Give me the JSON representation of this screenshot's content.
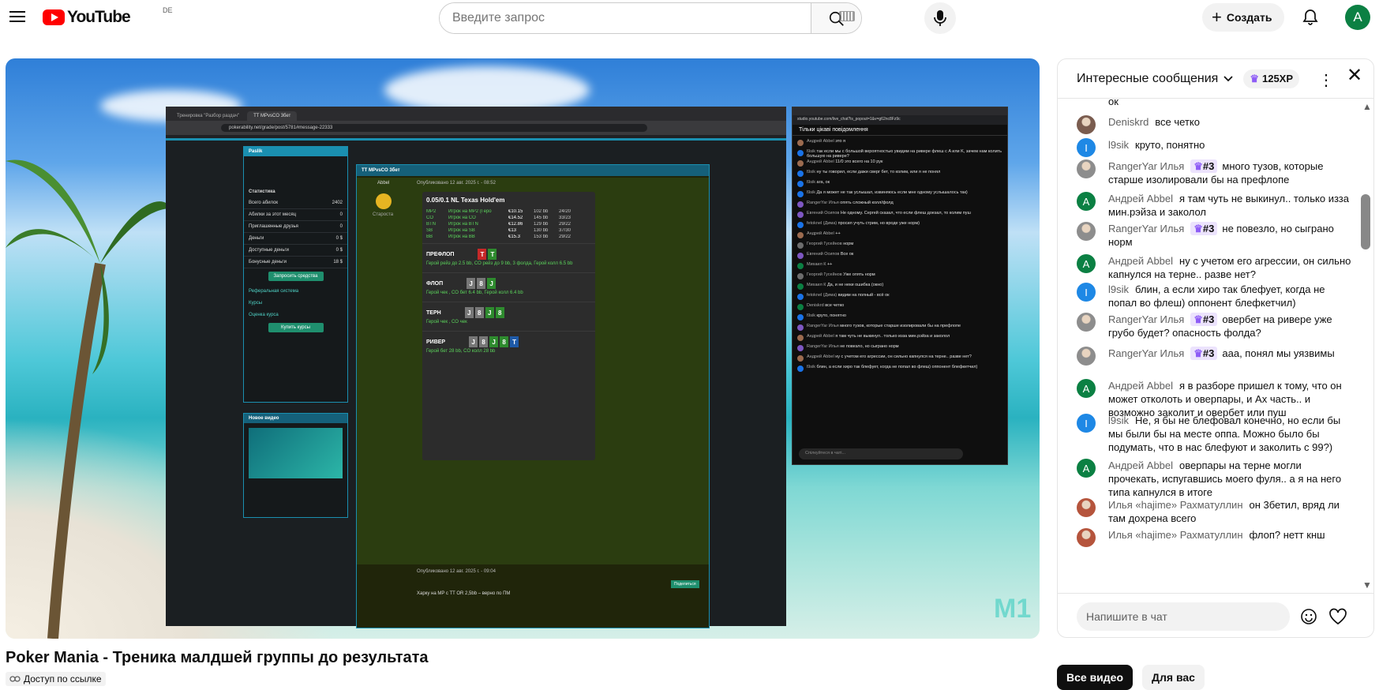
{
  "header": {
    "logo_text": "YouTube",
    "country_code": "DE",
    "search_placeholder": "Введите запрос",
    "create_label": "Создать",
    "avatar_letter": "A"
  },
  "video": {
    "title": "Poker Mania - Треника малдшей группы до результата",
    "access_label": "Доступ по ссылке",
    "watermark": "M1"
  },
  "screen_browser": {
    "tab1": "Тренировка \"Разбор раздач\"",
    "tab2": "TT MPvsCO 3бет",
    "url": "pokerability.net/grade/post/5781#message-22333",
    "user": "Paslik",
    "stats_title": "Статистика",
    "stats": [
      {
        "k": "Всего абилок",
        "v": "2402"
      },
      {
        "k": "Абилки за этот месяц",
        "v": "0"
      },
      {
        "k": "Приглашенные друзья",
        "v": "0"
      },
      {
        "k": "Деньги",
        "v": "0 $"
      },
      {
        "k": "Доступные деньги",
        "v": "0 $"
      },
      {
        "k": "Бонусные деньги",
        "v": "18 $"
      }
    ],
    "withdraw_btn": "Запросить средства",
    "links": [
      "Реферальная система",
      "Курсы",
      "Оценка курса"
    ],
    "buy_btn": "Купить курсы",
    "new_video": "Новое видео",
    "post_title": "TT MPvsCO 3бет",
    "author": "Abbel",
    "rank": "Староста",
    "published": "Опубликовано 12 авг. 2025 г. - 08:52",
    "game": "0.05/0.1 NL Texas Hold'em",
    "players": [
      {
        "pos": "MP2",
        "name": "Игрок на MP2 (Геро",
        "stack": "€10.15",
        "bb": "102 bb",
        "stat": "24/20"
      },
      {
        "pos": "CO",
        "name": "Игрок на CO",
        "stack": "€14.52",
        "bb": "145 bb",
        "stat": "33/23"
      },
      {
        "pos": "BTN",
        "name": "Игрок на BTN",
        "stack": "€12.86",
        "bb": "129 bb",
        "stat": "29/22"
      },
      {
        "pos": "SB",
        "name": "Игрок на SB",
        "stack": "€13",
        "bb": "130 bb",
        "stat": "37/30"
      },
      {
        "pos": "BB",
        "name": "Игрок на BB",
        "stack": "€15.3",
        "bb": "153 bb",
        "stat": "29/22"
      }
    ],
    "streets": [
      {
        "name": "ПРЕФЛОП",
        "cards": [
          "T",
          "T"
        ],
        "colors": [
          "r",
          "g"
        ],
        "action": "Герой рейз до 2.5 bb, CO рейз до 9 bb, 3 фолда, Герой колл 6.5 bb"
      },
      {
        "name": "ФЛОП",
        "cards": [
          "J",
          "8",
          "J"
        ],
        "colors": [
          "",
          "",
          "g"
        ],
        "action": "Герой чек , CO бет 6.4 bb, Герой колл 6.4 bb"
      },
      {
        "name": "ТЕРН",
        "cards": [
          "J",
          "8",
          "J",
          "8"
        ],
        "colors": [
          "",
          "",
          "g",
          "g"
        ],
        "action": "Герой чек , CO чек"
      },
      {
        "name": "РИВЕР",
        "cards": [
          "J",
          "8",
          "J",
          "8",
          "T"
        ],
        "colors": [
          "",
          "",
          "g",
          "g",
          "b"
        ],
        "action": "Герой бет 28 bb, CO колл 28 bb"
      }
    ],
    "share_btn": "Поделиться",
    "reply_published": "Опубликовано 12 авг. 2025 г. - 09:04",
    "reply_line": "Харку на MP c TT OR 2,5bb – верно по ПМ"
  },
  "screen_chat": {
    "url": "studio.youtube.com/live_chat?is_popout=1&v=g62nc8Fz9c",
    "header": "Тільки цікаві повідомлення",
    "input": "Спілкуйтеся в чаті...",
    "messages": [
      {
        "a": "Андрей Abbel",
        "t": "это я"
      },
      {
        "a": "l9sik",
        "t": "так если мы с большой вероятностью увидим на ривере флеш с A или K, зачем нам колить большую на ривере?"
      },
      {
        "a": "Андрей Abbel",
        "t": "11/0 это всего на 10 рук"
      },
      {
        "a": "l9sik",
        "t": "ну ты говорил, если дажи сверг бет, то колим, или я не понял"
      },
      {
        "a": "l9sik",
        "t": "ага, ок"
      },
      {
        "a": "l9sik",
        "t": "Да я может не так услышал, извиняюсь если мне одному услышалось так)"
      },
      {
        "a": "RangerYar Илья",
        "t": "опять сложный колл/фолд"
      },
      {
        "a": "Евгений Осипов",
        "t": "Не одному. Сергей сказал, что если флеш доезал, то колим пуш"
      },
      {
        "a": "fetoknel (Дима)",
        "t": "просил учуть стрим, но вроде уже норм)"
      },
      {
        "a": "Андрей Abbel",
        "t": "++"
      },
      {
        "a": "Георгий Гусейнов",
        "t": "норм"
      },
      {
        "a": "Евгений Осипов",
        "t": "Все ок"
      },
      {
        "a": "Михаил К",
        "t": "++"
      },
      {
        "a": "Георгий Гусейнов",
        "t": "Уже опять норм"
      },
      {
        "a": "Михаил К",
        "t": "Да, и не неки ошибка (окно)"
      },
      {
        "a": "fetoknel (Дима)",
        "t": "видим на полный - всё ок"
      },
      {
        "a": "Deniskrd",
        "t": "все четко"
      },
      {
        "a": "l9sik",
        "t": "круто, понятно"
      },
      {
        "a": "RangerYar Илья",
        "t": "много тузов, которые старше изолировали бы на префлопе"
      },
      {
        "a": "Андрей Abbel",
        "t": "я там чуть не выкинул.. только изза мин.рэйза и заколол"
      },
      {
        "a": "RangerYar Илья",
        "t": "не повезло, но сыграно норм"
      },
      {
        "a": "Андрей Abbel",
        "t": "ну с учетом его агрессии, он сильно капнулся на терне.. разве нет?"
      },
      {
        "a": "l9sik",
        "t": "блин, а если хиро так блефует, когда не попал во флеш) оппонент блефкетчил)"
      }
    ]
  },
  "chat": {
    "header_title": "Интересные сообщения",
    "xp_label": "125XP",
    "input_placeholder": "Напишите в чат",
    "partial_top": "ок",
    "messages": [
      {
        "author": "Deniskrd",
        "badge": "",
        "text": "все четко",
        "avatar": "img",
        "color": "#7a5c4f"
      },
      {
        "author": "l9sik",
        "badge": "",
        "text": "круто, понятно",
        "avatar": "I",
        "color": "#1e88e5"
      },
      {
        "author": "RangerYar Илья",
        "badge": "#3",
        "text": "много тузов, которые старше изолировали бы на префлопе",
        "avatar": "img",
        "color": "#8d8d8d"
      },
      {
        "author": "Андрей Abbel",
        "badge": "",
        "text": "я там чуть не выкинул.. только изза мин.рэйза и заколол",
        "avatar": "A",
        "color": "#0b8043"
      },
      {
        "author": "RangerYar Илья",
        "badge": "#3",
        "text": "не повезло, но сыграно норм",
        "avatar": "img",
        "color": "#8d8d8d"
      },
      {
        "author": "Андрей Abbel",
        "badge": "",
        "text": "ну с учетом его агрессии, он сильно капнулся на терне.. разве нет?",
        "avatar": "A",
        "color": "#0b8043"
      },
      {
        "author": "l9sik",
        "badge": "",
        "text": "блин, а если хиро так блефует, когда не попал во флеш) оппонент блефкетчил)",
        "avatar": "I",
        "color": "#1e88e5"
      },
      {
        "author": "RangerYar Илья",
        "badge": "#3",
        "text": "овербет на ривере уже грубо будет? опасность фолда?",
        "avatar": "img",
        "color": "#8d8d8d"
      },
      {
        "author": "RangerYar Илья",
        "badge": "#3",
        "text": "ааа, понял мы уязвимы",
        "avatar": "img",
        "color": "#8d8d8d"
      },
      {
        "author": "Андрей Abbel",
        "badge": "",
        "text": "я в разборе пришел к тому, что он может отколоть и оверпары, и Ax часть.. и возможно заколит и овербет или пуш",
        "avatar": "A",
        "color": "#0b8043"
      },
      {
        "author": "l9sik",
        "badge": "",
        "text": "Не, я бы не блефовал конечно, но если бы мы были бы на месте оппа. Можно было бы подумать, что в нас блефуют и заколить с 99?)",
        "avatar": "I",
        "color": "#1e88e5"
      },
      {
        "author": "Андрей Abbel",
        "badge": "",
        "text": "оверпары на терне могли прочекать, испугавшись моего фуля.. а я на него типа капнулся в итоге",
        "avatar": "A",
        "color": "#0b8043"
      },
      {
        "author": "Илья «hajime» Рахматуллин",
        "badge": "",
        "text": "он 3бетил, вряд ли там дохрена всего",
        "avatar": "img",
        "color": "#b5543c"
      },
      {
        "author": "Илья «hajime» Рахматуллин",
        "badge": "",
        "text": "флоп? нетт кнш",
        "avatar": "img",
        "color": "#b5543c"
      }
    ]
  },
  "chips": [
    "Все видео",
    "Для вас"
  ]
}
